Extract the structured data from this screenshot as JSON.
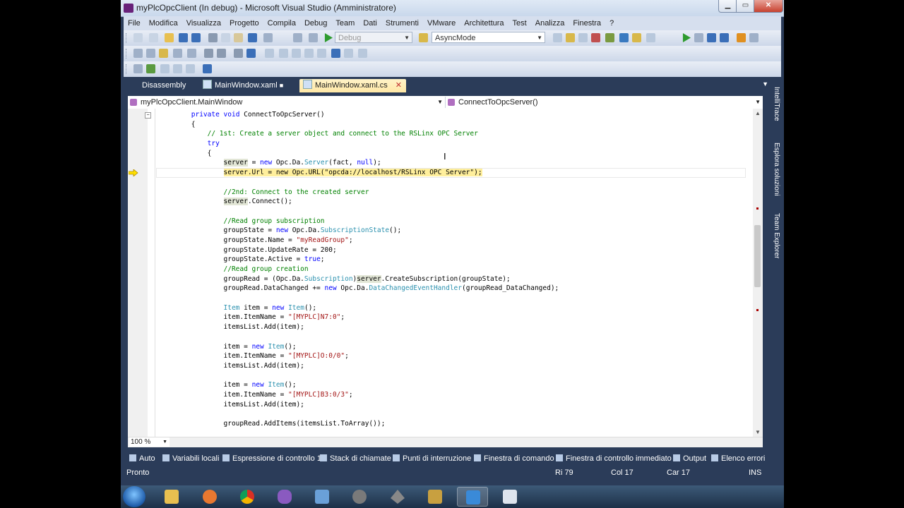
{
  "window": {
    "title": "myPlcOpcClient (In debug) - Microsoft Visual Studio (Amministratore)",
    "minimize": "▁",
    "maximize": "▭",
    "close": "✕"
  },
  "menu": [
    "File",
    "Modifica",
    "Visualizza",
    "Progetto",
    "Compila",
    "Debug",
    "Team",
    "Dati",
    "Strumenti",
    "VMware",
    "Architettura",
    "Test",
    "Analizza",
    "Finestra",
    "?"
  ],
  "toolbar": {
    "config": "Debug",
    "find": "AsyncMode"
  },
  "tabs": [
    {
      "label": "Disassembly",
      "active": false
    },
    {
      "label": "MainWindow.xaml",
      "active": false,
      "lock_icon": "lock-icon"
    },
    {
      "label": "MainWindow.xaml.cs",
      "active": true,
      "close": "✕"
    }
  ],
  "nav": {
    "class_combo": "myPlcOpcClient.MainWindow",
    "member_combo": "ConnectToOpcServer()"
  },
  "code_lines": [
    [
      {
        "t": "        "
      },
      {
        "t": "private",
        "c": "kw"
      },
      {
        "t": " "
      },
      {
        "t": "void",
        "c": "kw"
      },
      {
        "t": " ConnectToOpcServer()"
      }
    ],
    [
      {
        "t": "        {"
      }
    ],
    [
      {
        "t": "            "
      },
      {
        "t": "// 1st: Create a server object and connect to the RSLinx OPC Server",
        "c": "cm"
      }
    ],
    [
      {
        "t": "            "
      },
      {
        "t": "try",
        "c": "kw"
      }
    ],
    [
      {
        "t": "            {"
      }
    ],
    [
      {
        "t": "                "
      },
      {
        "t": "server",
        "c": "ref"
      },
      {
        "t": " = "
      },
      {
        "t": "new",
        "c": "kw"
      },
      {
        "t": " Opc.Da."
      },
      {
        "t": "Server",
        "c": "ty"
      },
      {
        "t": "(fact, "
      },
      {
        "t": "null",
        "c": "kw"
      },
      {
        "t": ");"
      }
    ],
    [
      {
        "t": "                "
      },
      {
        "t": "server.Url = new Opc.URL(\"opcda://localhost/RSLinx OPC Server\");",
        "c": "hl"
      }
    ],
    [
      {
        "t": ""
      }
    ],
    [
      {
        "t": "                "
      },
      {
        "t": "//2nd: Connect to the created server",
        "c": "cm"
      }
    ],
    [
      {
        "t": "                "
      },
      {
        "t": "server",
        "c": "ref"
      },
      {
        "t": ".Connect();"
      }
    ],
    [
      {
        "t": ""
      }
    ],
    [
      {
        "t": "                "
      },
      {
        "t": "//Read group subscription",
        "c": "cm"
      }
    ],
    [
      {
        "t": "                groupState = "
      },
      {
        "t": "new",
        "c": "kw"
      },
      {
        "t": " Opc.Da."
      },
      {
        "t": "SubscriptionState",
        "c": "ty"
      },
      {
        "t": "();"
      }
    ],
    [
      {
        "t": "                groupState.Name = "
      },
      {
        "t": "\"myReadGroup\"",
        "c": "st"
      },
      {
        "t": ";"
      }
    ],
    [
      {
        "t": "                groupState.UpdateRate = 200;"
      }
    ],
    [
      {
        "t": "                groupState.Active = "
      },
      {
        "t": "true",
        "c": "kw"
      },
      {
        "t": ";"
      }
    ],
    [
      {
        "t": "                "
      },
      {
        "t": "//Read group creation",
        "c": "cm"
      }
    ],
    [
      {
        "t": "                groupRead = (Opc.Da."
      },
      {
        "t": "Subscription",
        "c": "ty"
      },
      {
        "t": ")"
      },
      {
        "t": "server",
        "c": "ref"
      },
      {
        "t": ".CreateSubscription(groupState);"
      }
    ],
    [
      {
        "t": "                groupRead.DataChanged += "
      },
      {
        "t": "new",
        "c": "kw"
      },
      {
        "t": " Opc.Da."
      },
      {
        "t": "DataChangedEventHandler",
        "c": "ty"
      },
      {
        "t": "(groupRead_DataChanged);"
      }
    ],
    [
      {
        "t": ""
      }
    ],
    [
      {
        "t": "                "
      },
      {
        "t": "Item",
        "c": "ty"
      },
      {
        "t": " item = "
      },
      {
        "t": "new",
        "c": "kw"
      },
      {
        "t": " "
      },
      {
        "t": "Item",
        "c": "ty"
      },
      {
        "t": "();"
      }
    ],
    [
      {
        "t": "                item.ItemName = "
      },
      {
        "t": "\"[MYPLC]N7:0\"",
        "c": "st"
      },
      {
        "t": ";"
      }
    ],
    [
      {
        "t": "                itemsList.Add(item);"
      }
    ],
    [
      {
        "t": ""
      }
    ],
    [
      {
        "t": "                item = "
      },
      {
        "t": "new",
        "c": "kw"
      },
      {
        "t": " "
      },
      {
        "t": "Item",
        "c": "ty"
      },
      {
        "t": "();"
      }
    ],
    [
      {
        "t": "                item.ItemName = "
      },
      {
        "t": "\"[MYPLC]O:0/0\"",
        "c": "st"
      },
      {
        "t": ";"
      }
    ],
    [
      {
        "t": "                itemsList.Add(item);"
      }
    ],
    [
      {
        "t": ""
      }
    ],
    [
      {
        "t": "                item = "
      },
      {
        "t": "new",
        "c": "kw"
      },
      {
        "t": " "
      },
      {
        "t": "Item",
        "c": "ty"
      },
      {
        "t": "();"
      }
    ],
    [
      {
        "t": "                item.ItemName = "
      },
      {
        "t": "\"[MYPLC]B3:0/3\"",
        "c": "st"
      },
      {
        "t": ";"
      }
    ],
    [
      {
        "t": "                itemsList.Add(item);"
      }
    ],
    [
      {
        "t": ""
      }
    ],
    [
      {
        "t": "                groupRead.AddItems(itemsList.ToArray());"
      }
    ]
  ],
  "zoom": "100 %",
  "side_tabs": [
    "IntelliTrace",
    "Esplora soluzioni",
    "Team Explorer"
  ],
  "bottom_tabs": [
    "Auto",
    "Variabili locali",
    "Espressione di controllo 1",
    "Stack di chiamate",
    "Punti di interruzione",
    "Finestra di comando",
    "Finestra di controllo immediato",
    "Output",
    "Elenco errori"
  ],
  "status": {
    "ready": "Pronto",
    "row": "Ri 79",
    "col": "Col 17",
    "char": "Car 17",
    "mode": "INS"
  },
  "colors": {
    "frame": "#2b3c59",
    "highlight_line": "#ffef9c",
    "keyword": "#0000ff",
    "type": "#2b91af",
    "comment": "#008000",
    "string": "#a31515"
  }
}
